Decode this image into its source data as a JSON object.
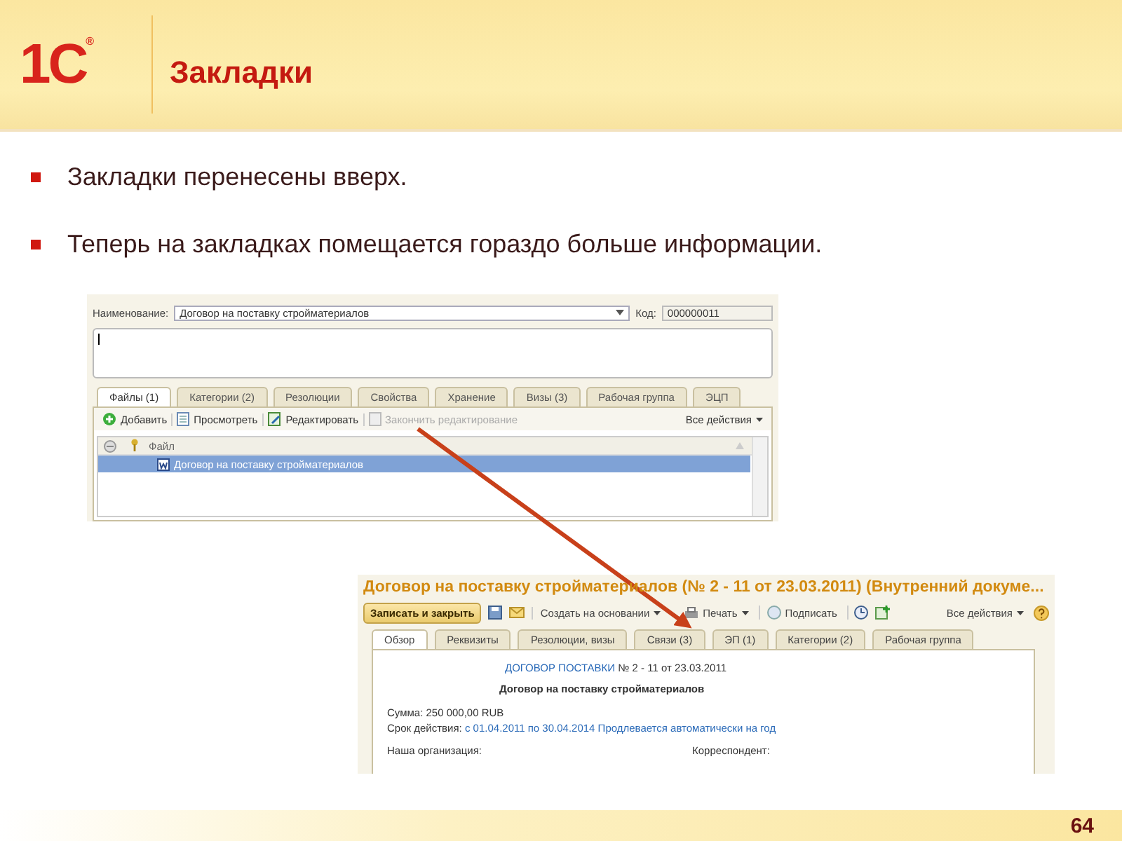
{
  "slide": {
    "logo": {
      "text": "1С",
      "mark": "®"
    },
    "title": "Закладки",
    "bullets": [
      "Закладки перенесены вверх.",
      "Теперь на закладках помещается гораздо больше информации."
    ],
    "page_number": "64"
  },
  "screenshot_1": {
    "name_label": "Наименование:",
    "name_value": "Договор на поставку стройматериалов",
    "code_label": "Код:",
    "code_value": "000000011",
    "tabs": [
      {
        "label": "Файлы (1)",
        "selected": true
      },
      {
        "label": "Категории (2)",
        "selected": false
      },
      {
        "label": "Резолюции",
        "selected": false
      },
      {
        "label": "Свойства",
        "selected": false
      },
      {
        "label": "Хранение",
        "selected": false
      },
      {
        "label": "Визы (3)",
        "selected": false
      },
      {
        "label": "Рабочая группа",
        "selected": false
      },
      {
        "label": "ЭЦП",
        "selected": false
      }
    ],
    "toolbar": [
      {
        "kind": "add",
        "label": "Добавить",
        "disabled": false
      },
      {
        "kind": "view",
        "label": "Просмотреть",
        "disabled": false
      },
      {
        "kind": "edit",
        "label": "Редактировать",
        "disabled": false
      },
      {
        "kind": "finish",
        "label": "Закончить редактирование",
        "disabled": true
      }
    ],
    "all_actions": "Все действия",
    "table": {
      "columns": [
        "Файл"
      ],
      "rows": [
        {
          "file": "Договор на поставку стройматериалов",
          "selected": true
        }
      ]
    }
  },
  "screenshot_2": {
    "title": "Договор на поставку стройматериалов (№ 2 - 11 от 23.03.2011) (Внутренний докуме...",
    "toolbar": [
      {
        "kind": "primary",
        "label": "Записать и закрыть"
      },
      {
        "kind": "save"
      },
      {
        "kind": "mail"
      },
      {
        "kind": "menu",
        "label": "Создать на основании"
      },
      {
        "kind": "print",
        "label": "Печать"
      },
      {
        "kind": "sign",
        "label": "Подписать"
      },
      {
        "kind": "clock"
      },
      {
        "kind": "addnew"
      }
    ],
    "all_actions": "Все действия",
    "tabs": [
      {
        "label": "Обзор",
        "selected": true
      },
      {
        "label": "Реквизиты",
        "selected": false
      },
      {
        "label": "Резолюции, визы",
        "selected": false
      },
      {
        "label": "Связи (3)",
        "selected": false
      },
      {
        "label": "ЭП (1)",
        "selected": false
      },
      {
        "label": "Категории (2)",
        "selected": false
      },
      {
        "label": "Рабочая группа",
        "selected": false
      }
    ],
    "doc_link": "ДОГОВОР ПОСТАВКИ",
    "doc_number": "№ 2 - 11 от 23.03.2011",
    "doc_title": "Договор на поставку стройматериалов",
    "sum": "Сумма: 250 000,00 RUB",
    "term_label": "Срок действия:",
    "term_value": "с 01.04.2011 по 30.04.2014 Продлевается автоматически на год",
    "our_org_label": "Наша организация:",
    "correspondent_label": "Корреспондент:"
  }
}
